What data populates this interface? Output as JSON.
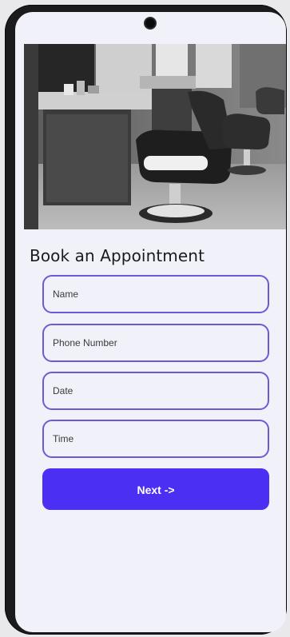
{
  "form": {
    "title": "Book an Appointment",
    "fields": [
      {
        "placeholder": "Name"
      },
      {
        "placeholder": "Phone Number"
      },
      {
        "placeholder": "Date"
      },
      {
        "placeholder": "Time"
      }
    ],
    "next_label": "Next ->"
  },
  "colors": {
    "accent": "#4b2ff2",
    "field_border": "#6a5ad6",
    "screen_bg": "#f1f2f9"
  }
}
